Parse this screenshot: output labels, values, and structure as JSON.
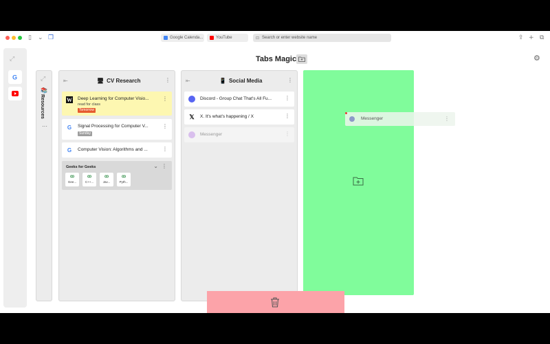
{
  "browser": {
    "tabs": [
      {
        "label": "Google Calenda...",
        "color": "#4285f4"
      },
      {
        "label": "YouTube",
        "color": "#ff0000"
      }
    ],
    "address_placeholder": "Search or enter website name"
  },
  "header": {
    "title": "Tabs Magic"
  },
  "rail": {
    "items": [
      "google-icon",
      "youtube-icon"
    ]
  },
  "collapsed_column": {
    "title": "Resources"
  },
  "columns": [
    {
      "title": "CV Research",
      "cards": [
        {
          "title": "Deep Learning for Computer Visio...",
          "favicon": "W",
          "note": "read for class",
          "badge": "Tomorrow",
          "badge_color": "#e65a2e",
          "highlight": "#fdf7b1"
        },
        {
          "title": "Signal Processing for Computer V...",
          "favicon": "G",
          "badge": "Sunday",
          "badge_color": "#9e9e9e"
        },
        {
          "title": "Computer Vision: Algorithms and ...",
          "favicon": "G"
        }
      ],
      "group": {
        "title": "Geeks for Geeks",
        "items": [
          "Gee...",
          "C++...",
          "Jav...",
          "Pyth..."
        ]
      }
    },
    {
      "title": "Social Media",
      "cards": [
        {
          "title": "Discord - Group Chat That's All Fu...",
          "favicon": "discord"
        },
        {
          "title": "X. It's what's happening / X",
          "favicon": "X"
        },
        {
          "title": "Messenger",
          "favicon": "messenger",
          "faded": true
        }
      ]
    }
  ],
  "dragging_item": {
    "title": "Messenger"
  },
  "colors": {
    "drop_zone": "#80fc9b",
    "trash_zone": "#fca3a9",
    "highlight": "#fdf7b1"
  }
}
